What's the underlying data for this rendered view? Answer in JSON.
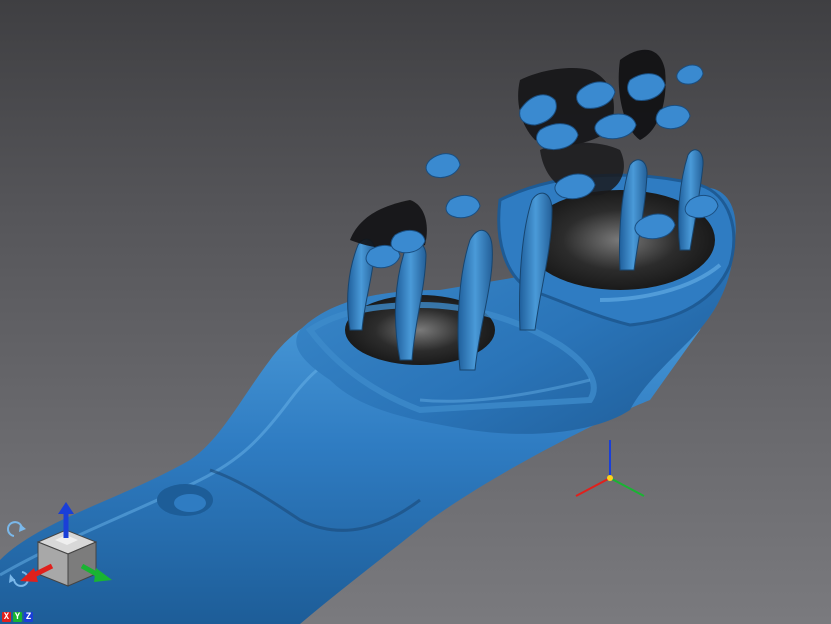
{
  "viewport": {
    "background_top": "#3f3f42",
    "background_bottom": "#7a7a7e",
    "model_color": "#2f7cc2",
    "model_dark": "#1a4a78"
  },
  "gizmo": {
    "rotate_icon_top": "rotate-cw-icon",
    "rotate_icon_bottom": "rotate-ccw-icon",
    "x_color": "#e0201c",
    "y_color": "#19b432",
    "z_color": "#1a3fd8"
  },
  "axis_labels": {
    "x": "X",
    "y": "Y",
    "z": "Z"
  },
  "origin_marker": {
    "icon": "origin-axes-icon"
  }
}
